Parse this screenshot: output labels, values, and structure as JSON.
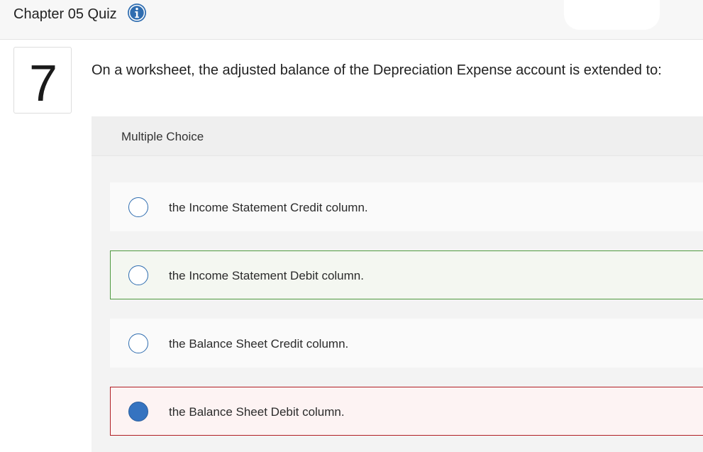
{
  "header": {
    "title": "Chapter 05 Quiz",
    "info_icon": "info-icon"
  },
  "question": {
    "number": "7",
    "text": "On a worksheet, the adjusted balance of the Depreciation Expense account is extended to:",
    "type_label": "Multiple Choice",
    "choices": [
      {
        "label": "the Income Statement Credit column.",
        "selected": false,
        "status": "neutral"
      },
      {
        "label": "the Income Statement Debit column.",
        "selected": false,
        "status": "correct"
      },
      {
        "label": "the Balance Sheet Credit column.",
        "selected": false,
        "status": "neutral"
      },
      {
        "label": "the Balance Sheet Debit column.",
        "selected": true,
        "status": "incorrect"
      }
    ]
  },
  "colors": {
    "accent": "#2f6db0",
    "correct_border": "#4f9a3f",
    "incorrect_border": "#b01e24"
  }
}
